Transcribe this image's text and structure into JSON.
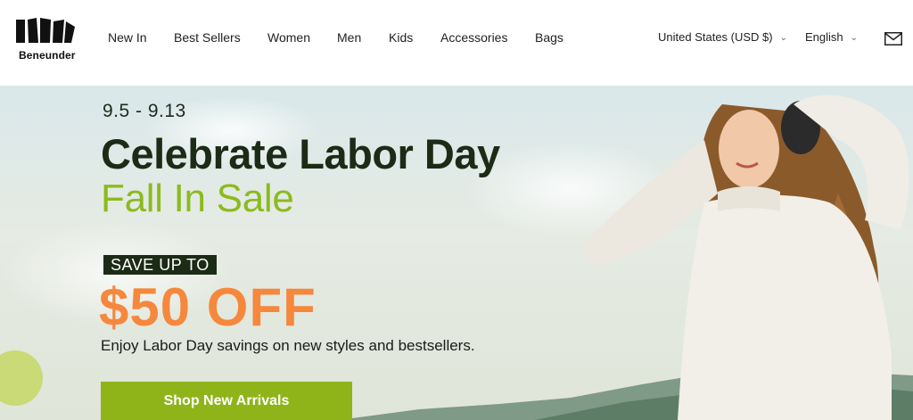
{
  "brand": {
    "name": "Beneunder"
  },
  "nav": {
    "items": [
      {
        "label": "New In"
      },
      {
        "label": "Best Sellers"
      },
      {
        "label": "Women"
      },
      {
        "label": "Men"
      },
      {
        "label": "Kids"
      },
      {
        "label": "Accessories"
      },
      {
        "label": "Bags"
      }
    ]
  },
  "utility": {
    "region": "United States (USD $)",
    "language": "English",
    "chevron": "⌄",
    "mail_icon": "mail-icon"
  },
  "hero": {
    "date_range": "9.5 - 9.13",
    "headline": "Celebrate Labor Day",
    "subline": "Fall In Sale",
    "badge": "SAVE UP TO",
    "offer": "$50 OFF",
    "description": "Enjoy Labor Day savings on new styles and bestsellers.",
    "cta": "Shop New Arrivals"
  },
  "colors": {
    "accent_green": "#8fb41a",
    "headline_dark": "#1c2b16",
    "offer_orange": "#f5883d",
    "subline_green": "#8bbb1d"
  }
}
